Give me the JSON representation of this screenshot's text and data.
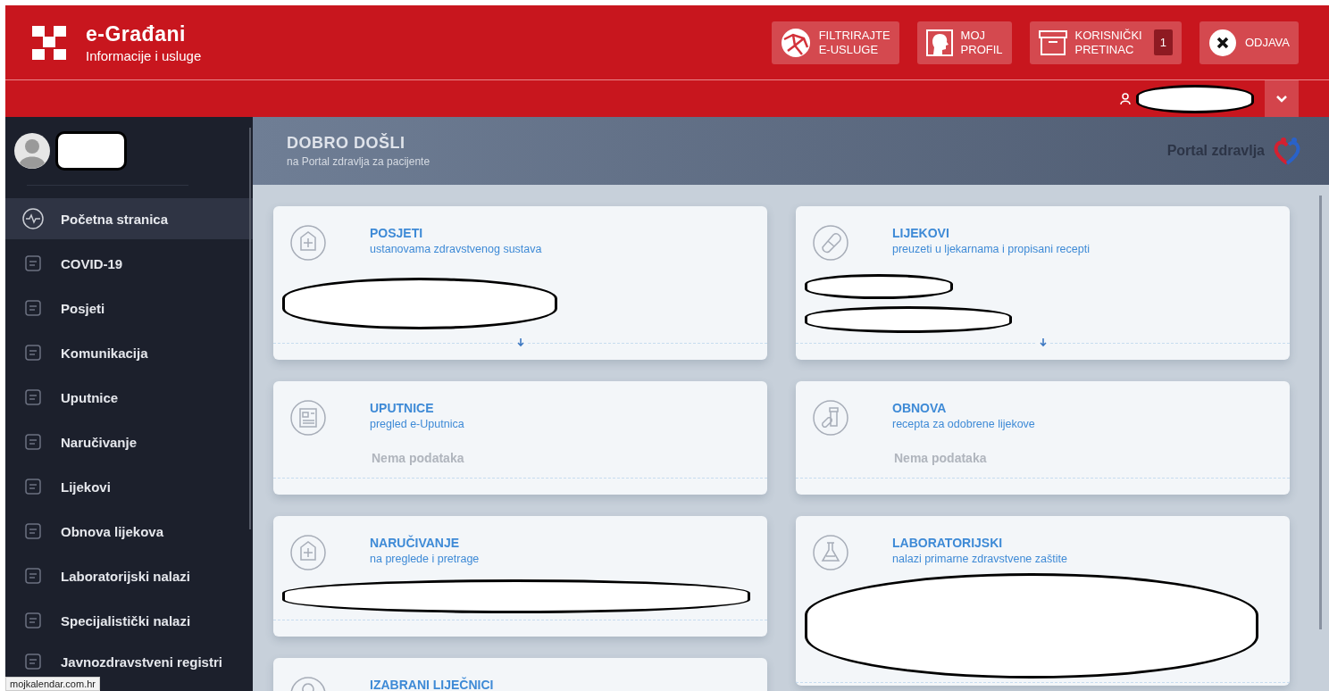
{
  "header": {
    "logo_title": "e-Građani",
    "logo_subtitle": "Informacije i usluge",
    "actions": [
      {
        "kind": "filter",
        "label_lines": [
          "FILTRIRAJTE",
          "E-USLUGE"
        ]
      },
      {
        "kind": "profile",
        "label_lines": [
          "MOJ",
          "PROFIL"
        ]
      },
      {
        "kind": "inbox",
        "label_lines": [
          "KORISNIČKI",
          "PRETINAC"
        ],
        "badge": "1"
      },
      {
        "kind": "logout",
        "label_lines": [
          "ODJAVA"
        ]
      }
    ],
    "user_menu": {
      "name_redacted": true,
      "expanded": false
    }
  },
  "sidebar": {
    "profile": {
      "name_redacted": true
    },
    "items": [
      {
        "label": "Početna stranica",
        "selected": true
      },
      {
        "label": "COVID-19",
        "selected": false
      },
      {
        "label": "Posjeti",
        "selected": false
      },
      {
        "label": "Komunikacija",
        "selected": false
      },
      {
        "label": "Uputnice",
        "selected": false
      },
      {
        "label": "Naručivanje",
        "selected": false
      },
      {
        "label": "Lijekovi",
        "selected": false
      },
      {
        "label": "Obnova lijekova",
        "selected": false
      },
      {
        "label": "Laboratorijski nalazi",
        "selected": false
      },
      {
        "label": "Specijalistički nalazi",
        "selected": false
      },
      {
        "label": "Javnozdravstveni registri",
        "selected": false
      }
    ]
  },
  "banner": {
    "title": "DOBRO DOŠLI",
    "subtitle": "na Portal zdravlja za pacijente",
    "brand": "Portal zdravlja"
  },
  "cards": [
    {
      "title": "POSJETI",
      "subtitle": "ustanovama zdravstvenog sustava",
      "body": {
        "kind": "redacted"
      },
      "expandable": true
    },
    {
      "title": "LIJEKOVI",
      "subtitle": "preuzeti u ljekarnama i propisani recepti",
      "body": {
        "kind": "redacted"
      },
      "expandable": true
    },
    {
      "title": "UPUTNICE",
      "subtitle": "pregled e-Uputnica",
      "body": {
        "kind": "empty",
        "text": "Nema podataka"
      },
      "expandable": false
    },
    {
      "title": "OBNOVA",
      "subtitle": "recepta za odobrene lijekove",
      "body": {
        "kind": "empty",
        "text": "Nema podataka"
      },
      "expandable": false
    },
    {
      "title": "NARUČIVANJE",
      "subtitle": "na preglede i pretrage",
      "body": {
        "kind": "redacted"
      },
      "expandable": false
    },
    {
      "title": "LABORATORIJSKI",
      "subtitle": "nalazi primarne zdravstvene zaštite",
      "body": {
        "kind": "redacted"
      },
      "expandable": false
    },
    {
      "title": "IZABRANI LIJEČNICI",
      "body": {
        "kind": "none"
      }
    }
  ],
  "status_url": "mojkalendar.com.hr"
}
